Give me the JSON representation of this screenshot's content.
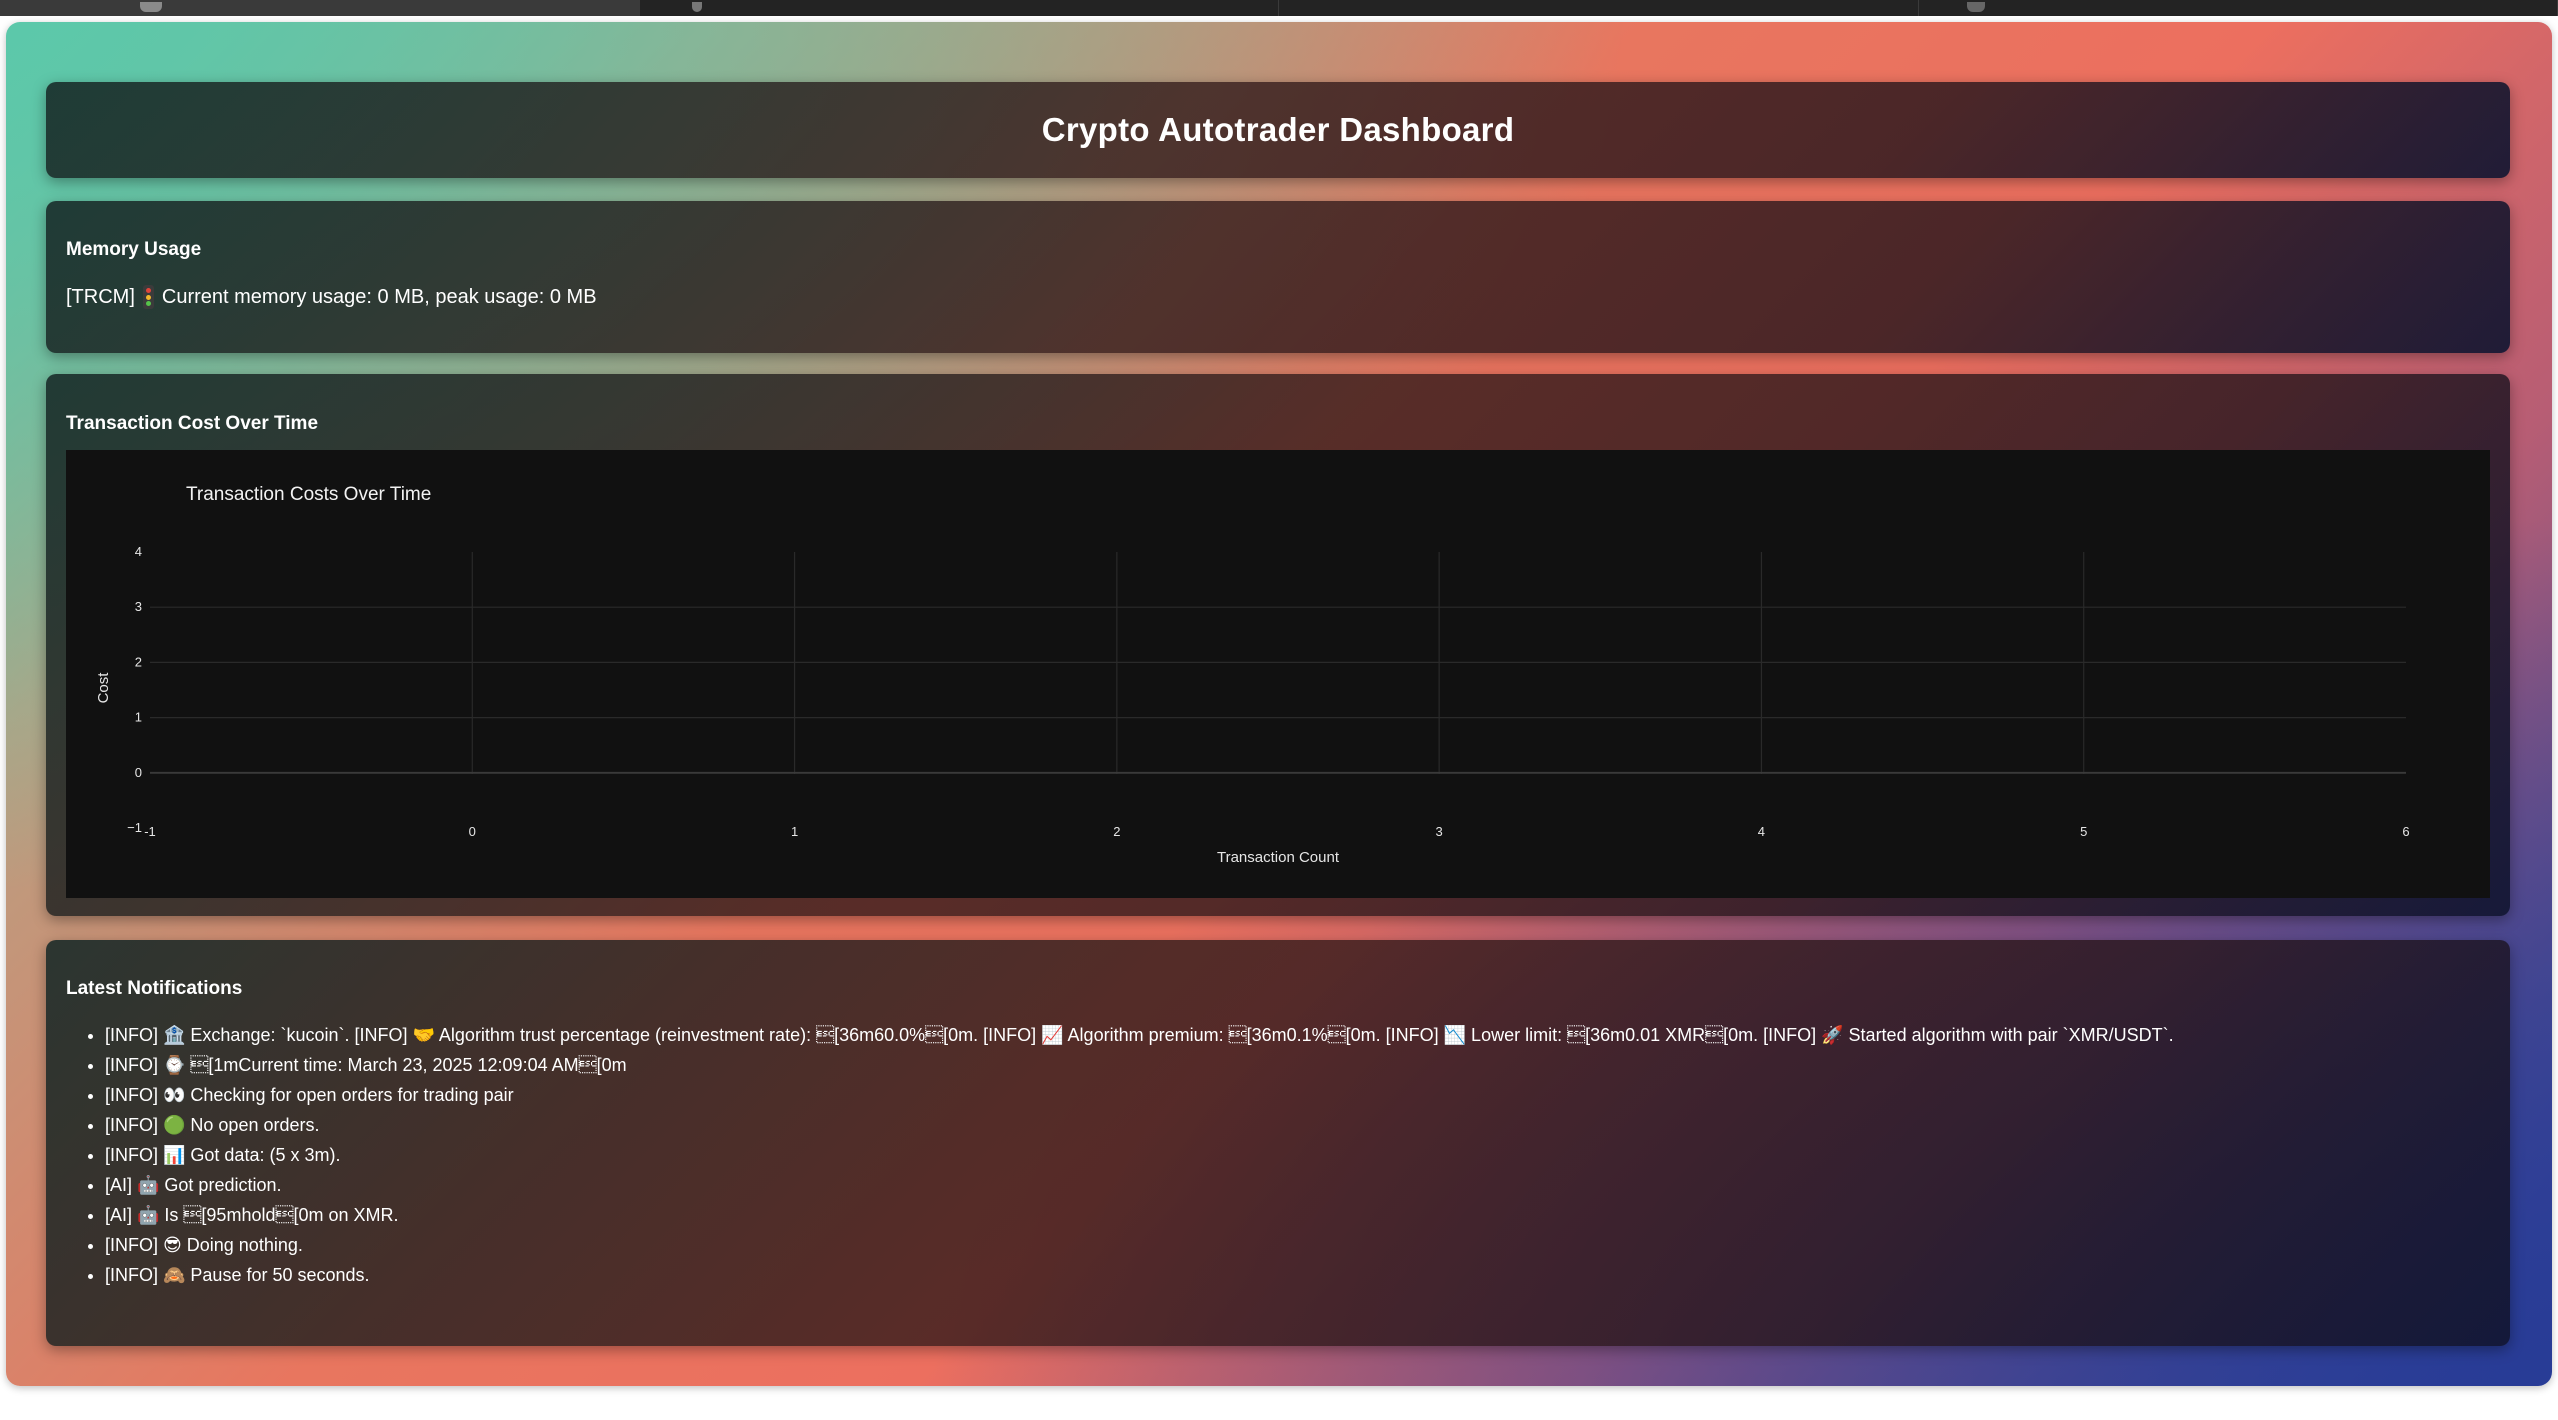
{
  "page": {
    "title": "Crypto Autotrader Dashboard"
  },
  "memory": {
    "title": "Memory Usage",
    "prefix": "[TRCM]",
    "text": "Current memory usage: 0 MB, peak usage: 0 MB",
    "icon": "traffic-light-icon"
  },
  "chart_section": {
    "title": "Transaction Cost Over Time"
  },
  "chart_data": {
    "type": "line",
    "title": "Transaction Costs Over Time",
    "xlabel": "Transaction Count",
    "ylabel": "Cost",
    "xlim": [
      -1,
      6
    ],
    "ylim": [
      -1,
      4
    ],
    "x_ticks": [
      -1,
      0,
      1,
      2,
      3,
      4,
      5,
      6
    ],
    "y_ticks": [
      -1,
      0,
      1,
      2,
      3,
      4
    ],
    "grid": true,
    "series": [],
    "background": "#111111"
  },
  "notifications": {
    "title": "Latest Notifications",
    "items": [
      "[INFO] 🏦 Exchange: `kucoin`. [INFO] 🤝 Algorithm trust percentage (reinvestment rate): \u001b[36m60.0%\u001b[0m. [INFO] 📈 Algorithm premium: \u001b[36m0.1%\u001b[0m. [INFO] 📉 Lower limit: \u001b[36m0.01 XMR\u001b[0m. [INFO] 🚀 Started algorithm with pair `XMR/USDT`.",
      "[INFO] ⌚ \u001b[1mCurrent time: March 23, 2025 12:09:04 AM\u001b[0m",
      "[INFO] 👀 Checking for open orders for trading pair",
      "[INFO] 🟢 No open orders.",
      "[INFO] 📊 Got data: (5 x 3m).",
      "[AI] 🤖 Got prediction.",
      "[AI] 🤖 Is \u001b[95mhold\u001b[0m on XMR.",
      "[INFO] 😎 Doing nothing.",
      "[INFO] 🙈 Pause for 50 seconds."
    ]
  },
  "colors": {
    "gradient_start": "#5fc7a6",
    "gradient_mid": "#ec6f5f",
    "gradient_end": "#2e3f9c",
    "card_text": "#ffffff",
    "chart_bg": "#111111"
  }
}
